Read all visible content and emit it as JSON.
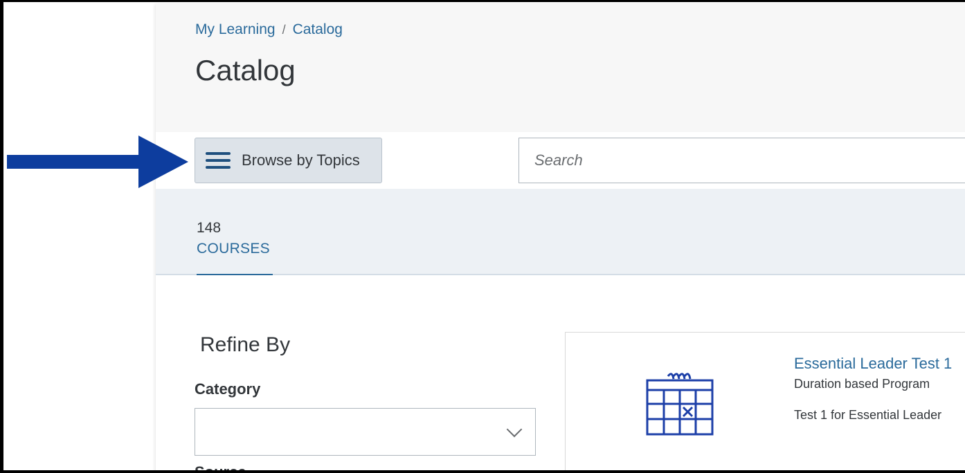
{
  "breadcrumb": {
    "home": "My Learning",
    "separator": "/",
    "current": "Catalog"
  },
  "page_title": "Catalog",
  "toolbar": {
    "browse_label": "Browse by Topics",
    "search_placeholder": "Search"
  },
  "tabs": {
    "count": "148",
    "label": "COURSES"
  },
  "refine": {
    "title": "Refine By",
    "category_label": "Category",
    "category_value": "",
    "source_label": "Source"
  },
  "course": {
    "title": "Essential Leader Test 1",
    "type": "Duration based Program",
    "description": "Test 1 for Essential Leader"
  },
  "colors": {
    "link": "#2a6a9b",
    "arrow": "#0d3d9e",
    "icon": "#1c3fa8",
    "button_bg": "#dde3e9",
    "tab_bg": "#edf1f5"
  }
}
